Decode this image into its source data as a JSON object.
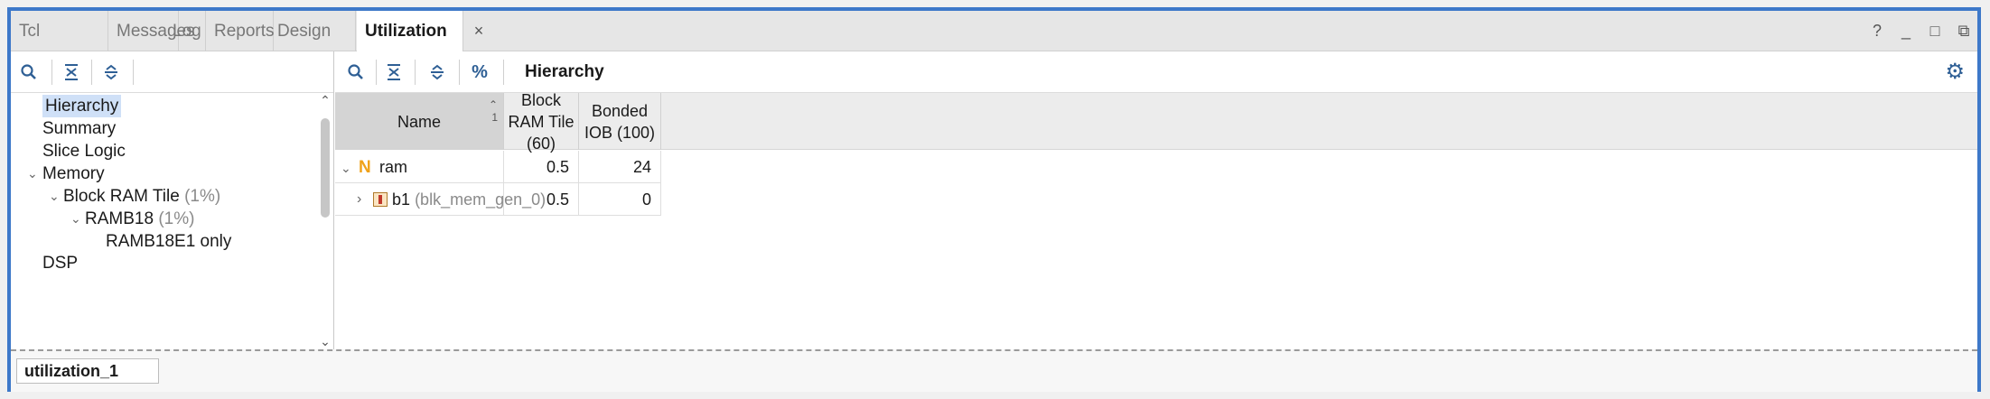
{
  "tabs": [
    {
      "label": "Tcl Console"
    },
    {
      "label": "Messages"
    },
    {
      "label": "Log"
    },
    {
      "label": "Reports"
    },
    {
      "label": "Design Runs"
    },
    {
      "label": "Utilization",
      "active": true
    }
  ],
  "tab_close_glyph": "×",
  "window_controls": [
    "?",
    "_",
    "□",
    "⧉"
  ],
  "left_tree": {
    "items": [
      {
        "label": "Hierarchy",
        "selected": true
      },
      {
        "label": "Summary"
      },
      {
        "label": "Slice Logic"
      },
      {
        "label": "Memory",
        "expanded": true
      },
      {
        "label": "Block RAM Tile",
        "suffix": "(1%)",
        "expanded": true
      },
      {
        "label": "RAMB18",
        "suffix": "(1%)",
        "expanded": true
      },
      {
        "label": "RAMB18E1 only"
      },
      {
        "label": "DSP"
      }
    ]
  },
  "right": {
    "title": "Hierarchy",
    "columns": [
      {
        "label": "Name",
        "sort_index": "1"
      },
      {
        "label": "Block RAM Tile (60)"
      },
      {
        "label": "Bonded IOB (100)"
      }
    ],
    "rows": [
      {
        "name": "ram",
        "detail": "",
        "icon": "netlist-n-icon",
        "expanded": true,
        "block_ram": "0.5",
        "bonded_iob": "24"
      },
      {
        "name": "b1",
        "detail": "(blk_mem_gen_0)",
        "icon": "block-instance-icon",
        "expanded": false,
        "block_ram": "0.5",
        "bonded_iob": "0"
      }
    ]
  },
  "bottom_tab": "utilization_1",
  "colors": {
    "frame_border": "#3d78c9",
    "selection": "#cfe0f7",
    "icon_blue": "#2e5f95",
    "netlist_orange": "#f0a21a"
  }
}
